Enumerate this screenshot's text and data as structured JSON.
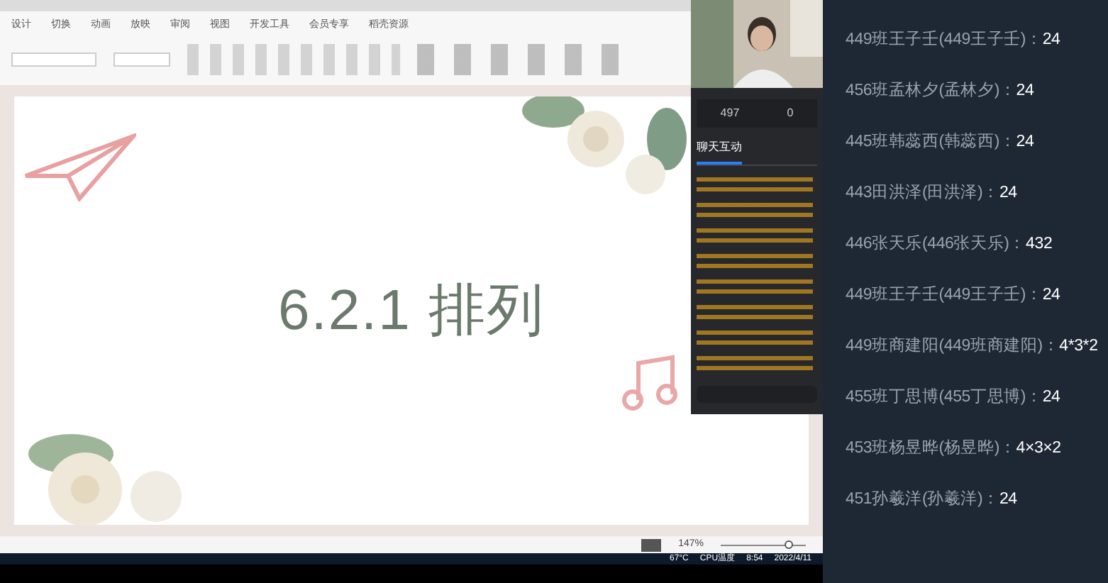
{
  "ribbon": {
    "tabs": [
      {
        "label": "设计",
        "selected": false
      },
      {
        "label": "切换",
        "selected": false
      },
      {
        "label": "动画",
        "selected": false
      },
      {
        "label": "放映",
        "selected": false
      },
      {
        "label": "审阅",
        "selected": false
      },
      {
        "label": "视图",
        "selected": false
      },
      {
        "label": "开发工具",
        "selected": false
      },
      {
        "label": "会员专享",
        "selected": false
      },
      {
        "label": "稻壳资源",
        "selected": false
      }
    ]
  },
  "slide": {
    "title": "6.2.1  排列"
  },
  "status_bar": {
    "zoom": "147%",
    "zoom_slider": {
      "level": 0.8
    }
  },
  "taskbar": {
    "temperature": "67°C",
    "temperature_label": "CPU温度",
    "time": "8:54",
    "date": "2022/4/11"
  },
  "live_panel": {
    "stats": [
      {
        "value": "497"
      },
      {
        "value": "0"
      }
    ],
    "tabs": [
      {
        "label": "聊天互动",
        "selected": true
      }
    ]
  },
  "answers": [
    {
      "name": "449班王子壬(449王子壬)：",
      "answer": "24"
    },
    {
      "name": "456班孟林夕(孟林夕)：",
      "answer": "24"
    },
    {
      "name": "445班韩蕊西(韩蕊西)：",
      "answer": "24"
    },
    {
      "name": "443田洪泽(田洪泽)：",
      "answer": "24"
    },
    {
      "name": "446张天乐(446张天乐)：",
      "answer": "432"
    },
    {
      "name": "449班王子壬(449王子壬)：",
      "answer": "24"
    },
    {
      "name": "449班商建阳(449班商建阳)：",
      "answer": "4*3*2"
    },
    {
      "name": "455班丁思博(455丁思博)：",
      "answer": "24"
    },
    {
      "name": "453班杨昱晔(杨昱晔)：",
      "answer": "4×3×2"
    },
    {
      "name": "451孙羲洋(孙羲洋)：",
      "answer": "24"
    }
  ]
}
